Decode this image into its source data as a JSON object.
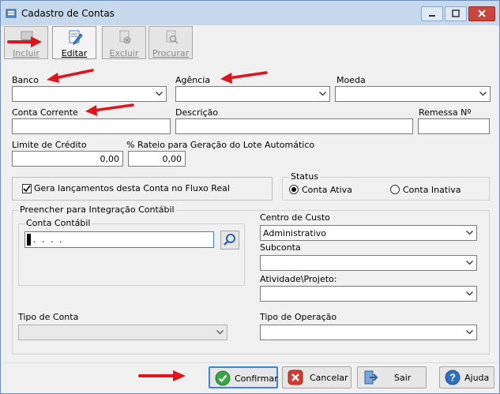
{
  "window": {
    "title": "Cadastro de Contas"
  },
  "toolbar": {
    "incluir": "Incluir",
    "editar": "Editar",
    "excluir": "Excluir",
    "procurar": "Procurar"
  },
  "form": {
    "banco": {
      "label": "Banco",
      "value": ""
    },
    "agencia": {
      "label": "Agência",
      "value": ""
    },
    "moeda": {
      "label": "Moeda",
      "value": ""
    },
    "conta_corrente": {
      "label": "Conta Corrente",
      "value": ""
    },
    "descricao": {
      "label": "Descrição",
      "value": ""
    },
    "remessa": {
      "label": "Remessa Nº",
      "value": ""
    },
    "limite_credito": {
      "label": "Limite de Crédito",
      "value": "0,00"
    },
    "rateio": {
      "label": "% Rateio para Geração do Lote Automático",
      "value": "0,00"
    },
    "gera_lancamentos": {
      "label": "Gera lançamentos desta Conta no Fluxo Real",
      "checked": true
    },
    "status": {
      "label": "Status",
      "options": [
        "Conta Ativa",
        "Conta Inativa"
      ],
      "selected": "Conta Ativa"
    },
    "integracao": {
      "label": "Preencher para Integração Contábil",
      "conta_contabil": {
        "label": "Conta Contábil",
        "value": ". . . ."
      }
    },
    "centro_custo": {
      "label": "Centro de Custo",
      "value": "Administrativo"
    },
    "subconta": {
      "label": "Subconta",
      "value": ""
    },
    "atividade": {
      "label": "Atividade\\Projeto:",
      "value": ""
    },
    "tipo_conta": {
      "label": "Tipo de Conta",
      "value": ""
    },
    "tipo_operacao": {
      "label": "Tipo de Operação",
      "value": ""
    }
  },
  "buttons": {
    "confirmar": "Confirmar",
    "cancelar": "Cancelar",
    "sair": "Sair",
    "ajuda": "Ajuda"
  },
  "colors": {
    "annotation_arrow": "#e0141c",
    "titlebar": "#c6d8ec",
    "focus_border": "#3b84d6"
  },
  "icons": [
    "app-icon",
    "minimize-icon",
    "maximize-icon",
    "close-icon",
    "add-record-icon",
    "edit-record-icon",
    "delete-record-icon",
    "search-record-icon",
    "search-icon",
    "chevron-down-icon",
    "confirm-icon",
    "cancel-icon",
    "exit-icon",
    "help-icon",
    "red-arrow-annotation"
  ]
}
